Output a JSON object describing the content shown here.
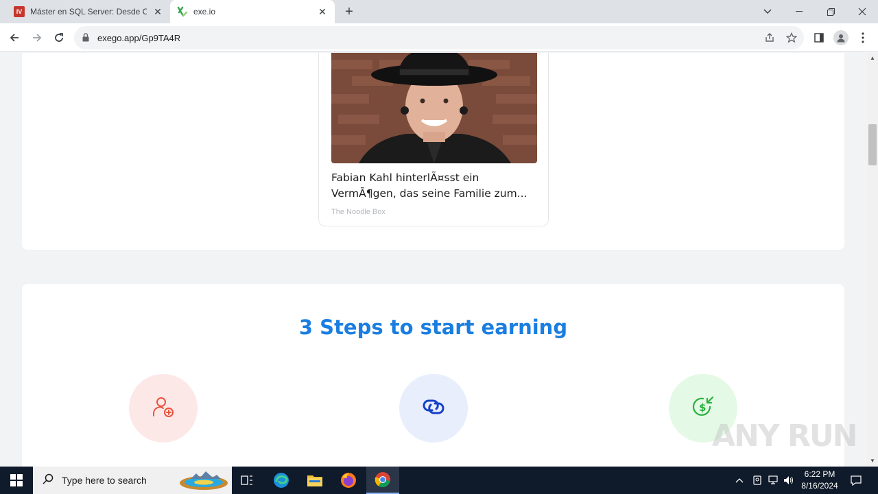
{
  "browser": {
    "tabs": [
      {
        "title": "Máster en SQL Server: Desde Cer",
        "icon": "udemy-favicon",
        "favicon_text": "IV"
      },
      {
        "title": "exe.io",
        "icon": "exeio-favicon"
      }
    ],
    "url": "exego.app/Gp9TA4R"
  },
  "article": {
    "title_line1": "Fabian Kahl hinterlÃ¤sst ein",
    "title_line2": "VermÃ¶gen, das seine Familie zum...",
    "source": "The Noodle Box"
  },
  "steps": {
    "title": "3 Steps to start earning",
    "items": [
      {
        "icon": "user-add-icon",
        "color": "#e8533b",
        "bg": "#fde8e8"
      },
      {
        "icon": "link-icon",
        "color": "#1640c8",
        "bg": "#e8eefc"
      },
      {
        "icon": "dollar-receive-icon",
        "color": "#27b03b",
        "bg": "#e4f9e6"
      }
    ]
  },
  "watermark": "ANY RUN",
  "taskbar": {
    "search_placeholder": "Type here to search",
    "time": "6:22 PM",
    "date": "8/16/2024"
  },
  "colors": {
    "accent": "#1a7ee0",
    "taskbar": "#0f1a2a"
  }
}
